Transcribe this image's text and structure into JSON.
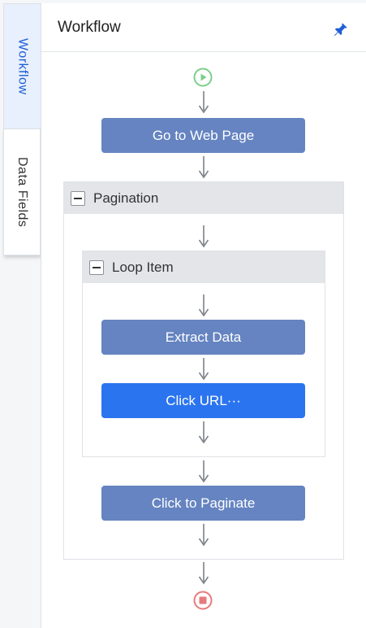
{
  "tabs": [
    {
      "label": "Workflow",
      "active": true
    },
    {
      "label": "Data Fields",
      "active": false
    }
  ],
  "panel": {
    "title": "Workflow",
    "pin_icon": "pin-icon"
  },
  "flow": {
    "start_icon": "play-circle-icon",
    "end_icon": "stop-circle-icon",
    "go_to_web_page": "Go to Web Page",
    "pagination": "Pagination",
    "loop_item": "Loop Item",
    "extract_data": "Extract Data",
    "click_url": "Click URL···",
    "click_to_paginate": "Click to Paginate"
  },
  "colors": {
    "accent": "#1f5fd6",
    "node": "#6584c1",
    "node_active": "#2b74f0",
    "start": "#7ccf8a",
    "stop": "#e77b7b"
  }
}
